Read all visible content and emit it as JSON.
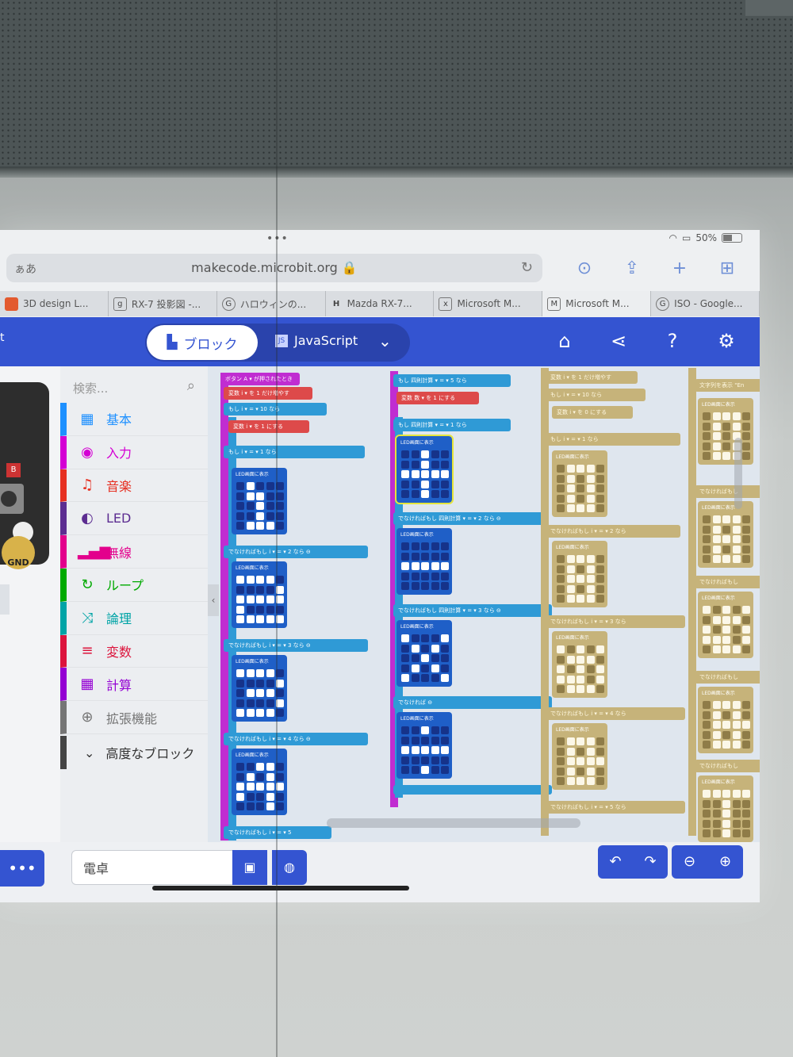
{
  "browser": {
    "status": {
      "battery": "50%",
      "dots": "•••"
    },
    "address": {
      "aa": "ぁあ",
      "url": "makecode.microbit.org 🔒"
    },
    "tabs": [
      {
        "label": "3D design L...",
        "icon": "tinkercad-icon"
      },
      {
        "label": "RX-7 投影図 -...",
        "icon": "g"
      },
      {
        "label": "ハロウィンの...",
        "icon": "G"
      },
      {
        "label": "Mazda RX-7...",
        "icon": "H"
      },
      {
        "label": "Microsoft M...",
        "icon": "x"
      },
      {
        "label": "Microsoft M...",
        "icon": "M"
      },
      {
        "label": "ISO - Google...",
        "icon": "G"
      }
    ]
  },
  "header": {
    "brand": "t",
    "blocks_label": "ブロック",
    "js_label": "JavaScript",
    "js_badge": "JS"
  },
  "simulator": {
    "pin_label": "-B",
    "gnd": "GND",
    "b_label": "B"
  },
  "toolbox": {
    "search_placeholder": "検索...",
    "categories": [
      {
        "label": "基本",
        "color": "#1e90ff",
        "icon": "grid-icon"
      },
      {
        "label": "入力",
        "color": "#d400d4",
        "icon": "circle-icon"
      },
      {
        "label": "音楽",
        "color": "#e63022",
        "icon": "headphones-icon"
      },
      {
        "label": "LED",
        "color": "#5c2d91",
        "icon": "toggle-icon"
      },
      {
        "label": "無線",
        "color": "#e3008c",
        "icon": "signal-icon"
      },
      {
        "label": "ループ",
        "color": "#00aa00",
        "icon": "loop-icon"
      },
      {
        "label": "論理",
        "color": "#00a4a6",
        "icon": "shuffle-icon"
      },
      {
        "label": "変数",
        "color": "#dc143c",
        "icon": "list-icon"
      },
      {
        "label": "計算",
        "color": "#9400d3",
        "icon": "calculator-icon"
      },
      {
        "label": "拡張機能",
        "color": "#757575",
        "icon": "plus-circle-icon"
      }
    ],
    "advanced_label": "高度なブロック"
  },
  "workspace": {
    "col1": {
      "event": "ボタン A ▾ が押されたとき",
      "change": "変数 i ▾ を 1 だけ増やす",
      "if1": "もし i ▾ = ▾ 10 なら",
      "set": "変数 i ▾ を 1 にする",
      "if2": "もし i ▾ = ▾ 1 なら",
      "led": "LED画面に表示",
      "elseif": [
        "でなければもし i ▾ = ▾ 2 なら ⊖",
        "でなければもし i ▾ = ▾ 3 なら ⊖",
        "でなければもし i ▾ = ▾ 4 なら ⊖",
        "でなければもし i ▾ = ▾ 5"
      ]
    },
    "col2": {
      "if1": "もし 四則計算 ▾ = ▾ 5 なら",
      "set": "変数 数 ▾ を 1 にする",
      "if2": "もし 四則計算 ▾ = ▾ 1 なら",
      "led": "LED画面に表示",
      "elseif": [
        "でなければもし 四則計算 ▾ = ▾ 2 なら ⊖",
        "でなければもし 四則計算 ▾ = ▾ 3 なら ⊖"
      ],
      "else": "でなければ ⊖"
    },
    "col3": {
      "top": [
        "変数 i ▾ を 1 だけ増やす",
        "もし i ▾ = ▾ 10 なら",
        "変数 i ▾ を 0 にする"
      ],
      "if": "もし i ▾ = ▾ 1 なら",
      "led": "LED画面に表示",
      "elseif": [
        "でなければもし i ▾ = ▾ 2 なら",
        "でなければもし i ▾ = ▾ 3 なら",
        "でなければもし i ▾ = ▾ 4 なら",
        "でなければもし i ▾ = ▾ 5 なら"
      ]
    },
    "col4": {
      "top": "文字列を表示 \"En",
      "led": "LED画面に表示",
      "elseif": "でなければもし"
    }
  },
  "bottom": {
    "more": "•••",
    "project_name": "電卓"
  },
  "colors": {
    "brand_blue": "#3454d1",
    "variables_red": "#dd4a4a",
    "logic_blue": "#2f9ad6",
    "led_blue": "#1f5fc7"
  }
}
